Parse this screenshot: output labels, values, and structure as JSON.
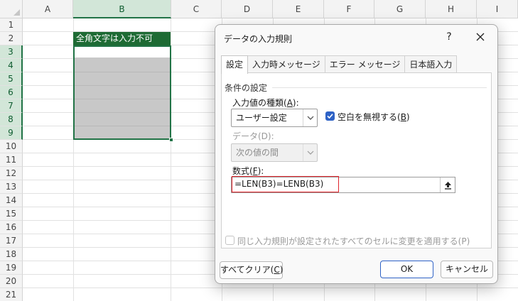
{
  "sheet": {
    "columns": [
      "A",
      "B",
      "C",
      "D",
      "E",
      "F",
      "G",
      "H",
      "I"
    ],
    "rows": [
      "1",
      "2",
      "3",
      "4",
      "5",
      "6",
      "7",
      "8",
      "9",
      "10",
      "11",
      "12",
      "13",
      "14",
      "15",
      "16",
      "17",
      "18",
      "19",
      "20",
      "21"
    ],
    "cell_b2": "全角文字は入力不可",
    "selected_column": "B",
    "selected_range": "B3:B9",
    "header_color": "#1e6b34",
    "accent": "#217346"
  },
  "dialog": {
    "title": "データの入力規則",
    "help": "?",
    "close": "✕",
    "tabs": [
      "設定",
      "入力時メッセージ",
      "エラー メッセージ",
      "日本語入力"
    ],
    "active_tab": "設定",
    "group_label": "条件の設定",
    "allow_label_main": "入力値の種類(",
    "allow_label_key": "A",
    "allow_label_end": "):",
    "allow_value": "ユーザー設定",
    "ignore_blank_main": "空白を無視する(",
    "ignore_blank_key": "B",
    "ignore_blank_end": ")",
    "ignore_blank_checked": true,
    "data_label": "データ(D):",
    "data_value": "次の値の間",
    "formula_label_main": "数式(",
    "formula_label_key": "F",
    "formula_label_end": "):",
    "formula_value": "=LEN(B3)=LENB(B3)",
    "apply_all_label": "同じ入力規則が設定されたすべてのセルに変更を適用する(P)",
    "apply_all_checked": false,
    "clear_all_main": "すべてクリア(",
    "clear_all_key": "C",
    "clear_all_end": ")",
    "ok_label": "OK",
    "cancel_label": "キャンセル",
    "accent": "#2e62c6",
    "highlight": "#e0242b"
  }
}
